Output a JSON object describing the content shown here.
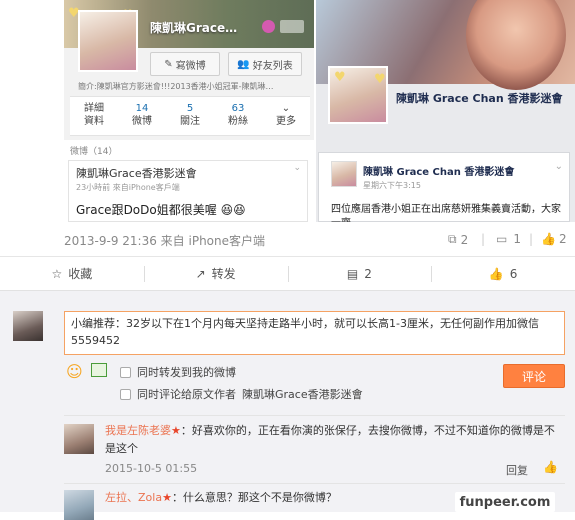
{
  "left_shot": {
    "profile_name": "陳凱琳Grace…",
    "buttons": {
      "message": "寫微博",
      "friends": "好友列表"
    },
    "intro": "簡介:陳凱琳官方影迷會!!!2013香港小姐冠軍-陳凱琳…",
    "stats": [
      {
        "num": "",
        "label": "詳細資料",
        "label2": "資料"
      },
      {
        "num": "14",
        "label": "微博"
      },
      {
        "num": "5",
        "label": "關注"
      },
      {
        "num": "63",
        "label": "粉絲"
      },
      {
        "num": "",
        "label": "更多"
      }
    ],
    "weibo_header": "微博（14）",
    "post_author": "陳凱琳Grace香港影迷會",
    "post_time": "23小時前 來自iPhone客戶端",
    "post_text": "Grace跟DoDo姐都很美喔"
  },
  "right_shot": {
    "page_name": "陳凱琳 Grace Chan 香港影迷會",
    "post_name": "陳凱琳 Grace Chan 香港影迷會",
    "post_time": "星期六下午3:15",
    "post_text": "四位應屆香港小姐正在出席慈妍雅集義賣活動，大家一齊"
  },
  "meta": {
    "timestamp": "2013-9-9 21:36 来自 iPhone客户端",
    "share_count": "2",
    "comment_count": "1",
    "like_count": "2"
  },
  "actions": {
    "favorite": "收藏",
    "forward": "转发",
    "comment": "2",
    "like": "6"
  },
  "comment_box": {
    "text": "小编推荐：32岁以下在1个月内每天坚持走路半小时，就可以长高1-3厘米，无任何副作用加微信5559452",
    "option1": "同时转发到我的微博",
    "option2_prefix": "同时评论给原文作者",
    "option2_author": "陳凱琳Grace香港影迷會",
    "submit": "评论"
  },
  "comments": [
    {
      "user": "我是左陈老婆",
      "text": "：好喜欢你的，正在看你演的张保仔，去搜你微博，不过不知道你的微博是不是这个",
      "time": "2015-10-5 01:55",
      "reply": "回复"
    },
    {
      "user": "左拉、Zola",
      "text": "：什么意思？那这个不是你微博？"
    }
  ],
  "watermark": "funpeer.com"
}
